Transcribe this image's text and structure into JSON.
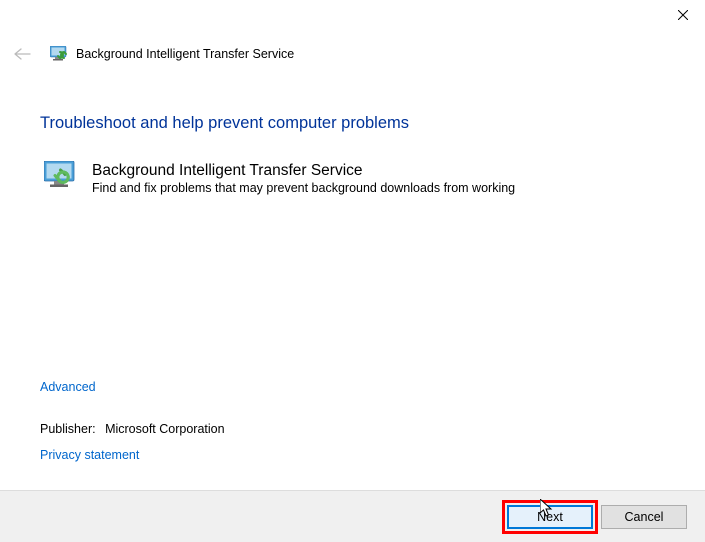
{
  "window": {
    "title": "Background Intelligent Transfer Service"
  },
  "main": {
    "heading": "Troubleshoot and help prevent computer problems",
    "service_name": "Background Intelligent Transfer Service",
    "service_desc": "Find and fix problems that may prevent background downloads from working"
  },
  "links": {
    "advanced": "Advanced",
    "privacy": "Privacy statement"
  },
  "publisher": {
    "label": "Publisher:",
    "name": "Microsoft Corporation"
  },
  "buttons": {
    "next": "Next",
    "cancel": "Cancel"
  }
}
